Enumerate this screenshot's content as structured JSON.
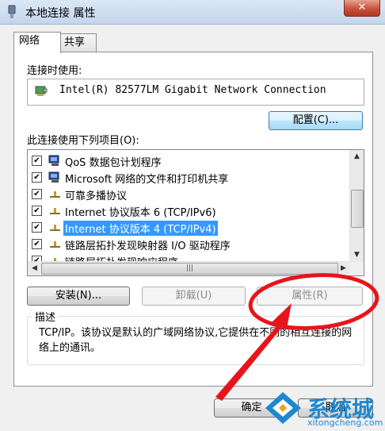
{
  "window": {
    "title": "本地连接 属性",
    "close_label": "✕"
  },
  "tabs": [
    {
      "label": "网络",
      "active": true
    },
    {
      "label": "共享",
      "active": false
    }
  ],
  "connect_using": {
    "label": "连接时使用:",
    "adapter_name": "Intel(R) 82577LM Gigabit Network Connection",
    "configure_button": "配置(C)..."
  },
  "items_label": "此连接使用下列项目(O):",
  "items": [
    {
      "label": "QoS 数据包计划程序",
      "checked": true,
      "icon": "network-client-icon",
      "selected": false
    },
    {
      "label": "Microsoft 网络的文件和打印机共享",
      "checked": true,
      "icon": "network-client-icon",
      "selected": false
    },
    {
      "label": "可靠多播协议",
      "checked": true,
      "icon": "protocol-icon",
      "selected": false
    },
    {
      "label": "Internet 协议版本 6 (TCP/IPv6)",
      "checked": true,
      "icon": "protocol-icon",
      "selected": false
    },
    {
      "label": "Internet 协议版本 4 (TCP/IPv4)",
      "checked": true,
      "icon": "protocol-icon",
      "selected": true
    },
    {
      "label": "链路层拓扑发现映射器 I/O 驱动程序",
      "checked": true,
      "icon": "protocol-icon",
      "selected": false
    },
    {
      "label": "链路层拓扑发现响应程序",
      "checked": true,
      "icon": "protocol-icon",
      "selected": false
    }
  ],
  "buttons": {
    "install": "安装(N)...",
    "uninstall": "卸载(U)",
    "properties": "属性(R)",
    "ok": "确定",
    "cancel": "取消"
  },
  "description": {
    "legend": "描述",
    "text": "TCP/IP。该协议是默认的广域网络协议,它提供在不同的相互连接的网络上的通讯。"
  },
  "watermark": {
    "brand": "系统城",
    "url": "xitongcheng.com"
  },
  "colors": {
    "selection": "#3399ff",
    "annotation_red": "#e8141b",
    "watermark_blue": "#1e88d0"
  }
}
